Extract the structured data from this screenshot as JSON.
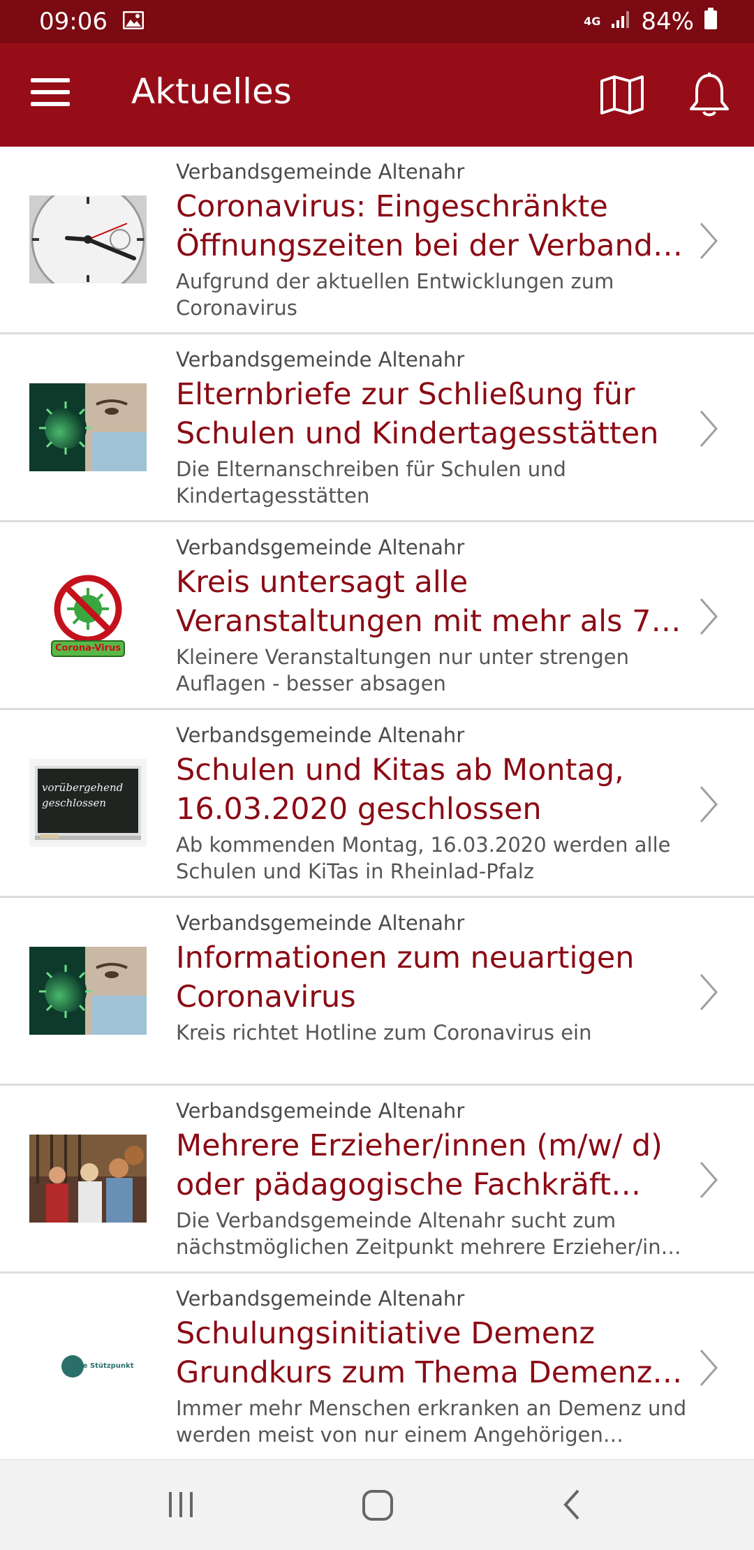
{
  "status": {
    "time": "09:06",
    "network": "4G",
    "battery": "84%"
  },
  "app_bar": {
    "title": "Aktuelles"
  },
  "items": [
    {
      "source": "Verbandsgemeinde Altenahr",
      "title": "Coronavirus: Eingeschränkte Öffnungszeiten bei der Verband…",
      "desc": "Aufgrund der aktuellen Entwicklungen zum Coronavirus",
      "thumb": "clock-photo"
    },
    {
      "source": "Verbandsgemeinde Altenahr",
      "title": "Elternbriefe zur Schließung für Schulen und Kindertagesstätten",
      "desc": "Die Elternanschreiben für Schulen und Kindertagesstätten",
      "thumb": "virus-mask-photo"
    },
    {
      "source": "Verbandsgemeinde Altenahr",
      "title": "Kreis untersagt alle Veranstaltungen mit mehr als 7…",
      "desc": "Kleinere Veranstaltungen nur unter strengen Auflagen - besser absagen",
      "thumb": "corona-virus-sign",
      "thumb_text": "Corona-Virus"
    },
    {
      "source": "Verbandsgemeinde Altenahr",
      "title": "Schulen und Kitas ab Montag, 16.03.2020 geschlossen",
      "desc": "Ab kommenden Montag, 16.03.2020 werden alle Schulen und KiTas in Rheinlad-Pfalz",
      "thumb": "chalkboard-photo",
      "thumb_text": "vorübergehend geschlossen"
    },
    {
      "source": "Verbandsgemeinde Altenahr",
      "title": "Informationen zum neuartigen Coronavirus",
      "desc": "Kreis richtet Hotline zum Coronavirus ein",
      "thumb": "virus-mask-photo"
    },
    {
      "source": "Verbandsgemeinde Altenahr",
      "title": "Mehrere Erzieher/innen (m/w/ d) oder pädagogische Fachkräft…",
      "desc": "Die Verbandsgemeinde Altenahr sucht zum nächstmöglichen Zeitpunkt mehrere Erzieher/in…",
      "thumb": "children-photo"
    },
    {
      "source": "Verbandsgemeinde Altenahr",
      "title": "Schulungsinitiative Demenz Grundkurs zum Thema Demenz i…",
      "desc": "Immer mehr Menschen erkranken an Demenz und werden meist von nur einem Angehörigen gepflegt.",
      "thumb": "pflege-stuetzpunkt-logo",
      "thumb_text": "Pflege Stützpunkt"
    }
  ],
  "colors": {
    "status_bar": "#7b0a12",
    "app_bar": "#960d18",
    "title_text": "#8b0a14"
  }
}
